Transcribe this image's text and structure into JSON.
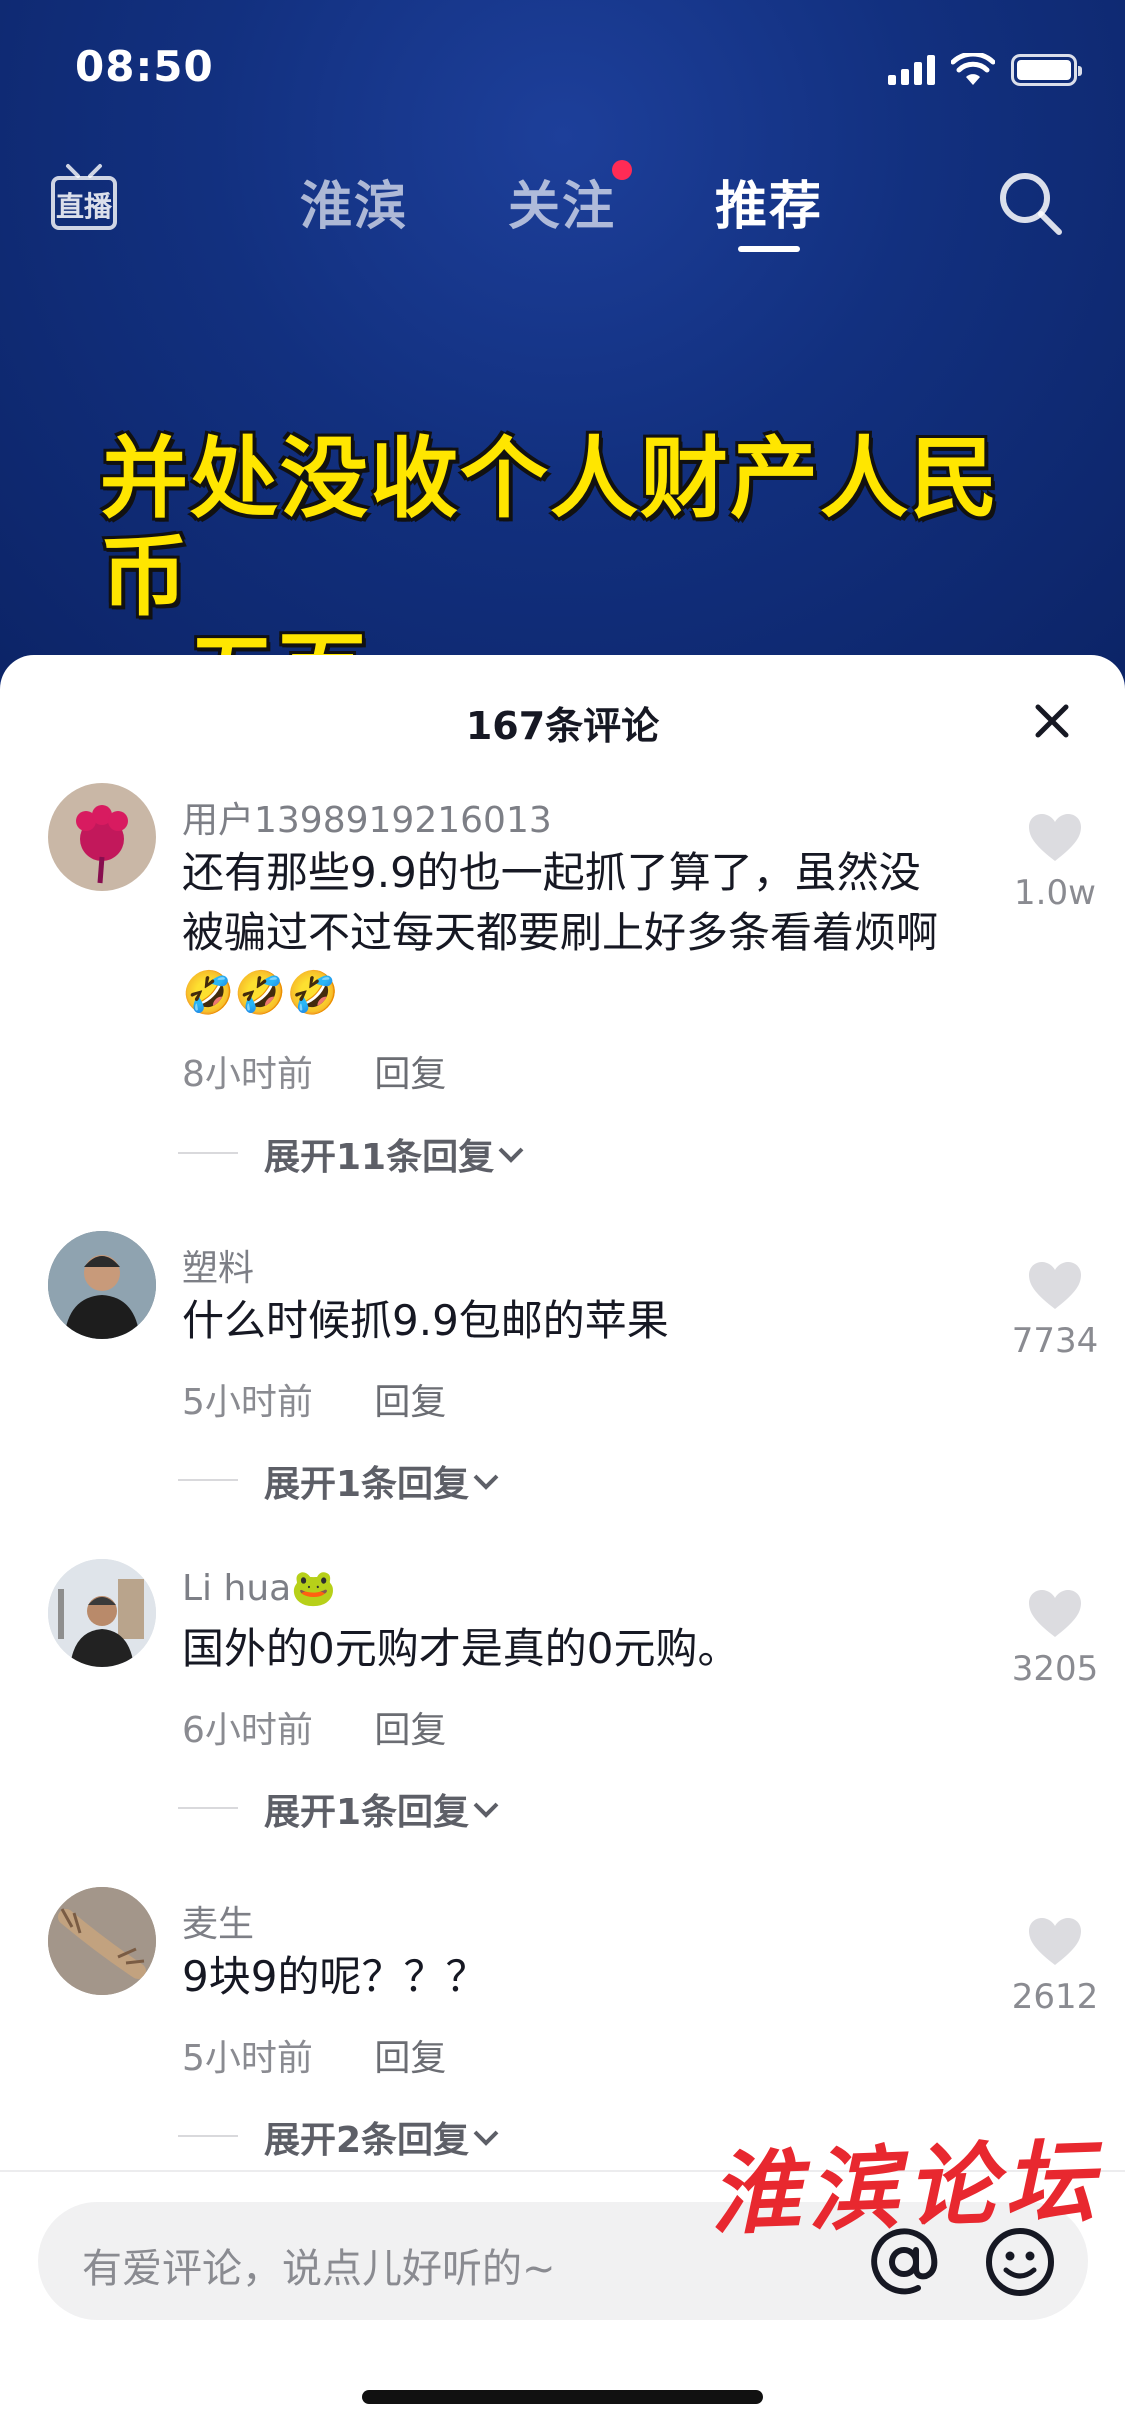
{
  "status_bar": {
    "time": "08:50"
  },
  "top_nav": {
    "live_label": "直播",
    "tabs": [
      {
        "label": "淮滨"
      },
      {
        "label": "关注"
      },
      {
        "label": "推荐"
      }
    ]
  },
  "video": {
    "caption_line1": "并处没收个人财产人民币",
    "caption_line2": "五百"
  },
  "comments_sheet": {
    "count_label": "167条评论",
    "comments": [
      {
        "user": "用户1398919216013",
        "text": "还有那些9.9的也一起抓了算了，虽然没被骗过不过每天都要刷上好多条看着烦啊🤣🤣🤣",
        "time": "8小时前",
        "reply_label": "回复",
        "expand_label": "展开11条回复",
        "likes": "1.0w"
      },
      {
        "user": "塑料",
        "text": "什么时候抓9.9包邮的苹果",
        "time": "5小时前",
        "reply_label": "回复",
        "expand_label": "展开1条回复",
        "likes": "7734"
      },
      {
        "user": "Li hua🐸",
        "text": "国外的0元购才是真的0元购。",
        "time": "6小时前",
        "reply_label": "回复",
        "expand_label": "展开1条回复",
        "likes": "3205"
      },
      {
        "user": "麦生",
        "text": "9块9的呢？？？",
        "time": "5小时前",
        "reply_label": "回复",
        "expand_label": "展开2条回复",
        "likes": "2612"
      }
    ]
  },
  "watermark": "淮滨论坛",
  "input": {
    "placeholder": "有爱评论，说点儿好听的~"
  },
  "colors": {
    "video_bg": "#12307f",
    "caption": "#ffe600",
    "notification_dot": "#ff2b55",
    "watermark": "#e8282f"
  },
  "icons": [
    "live-icon",
    "search-icon",
    "close-icon",
    "heart-icon",
    "at-icon",
    "emoji-icon",
    "chevron-down-icon"
  ]
}
